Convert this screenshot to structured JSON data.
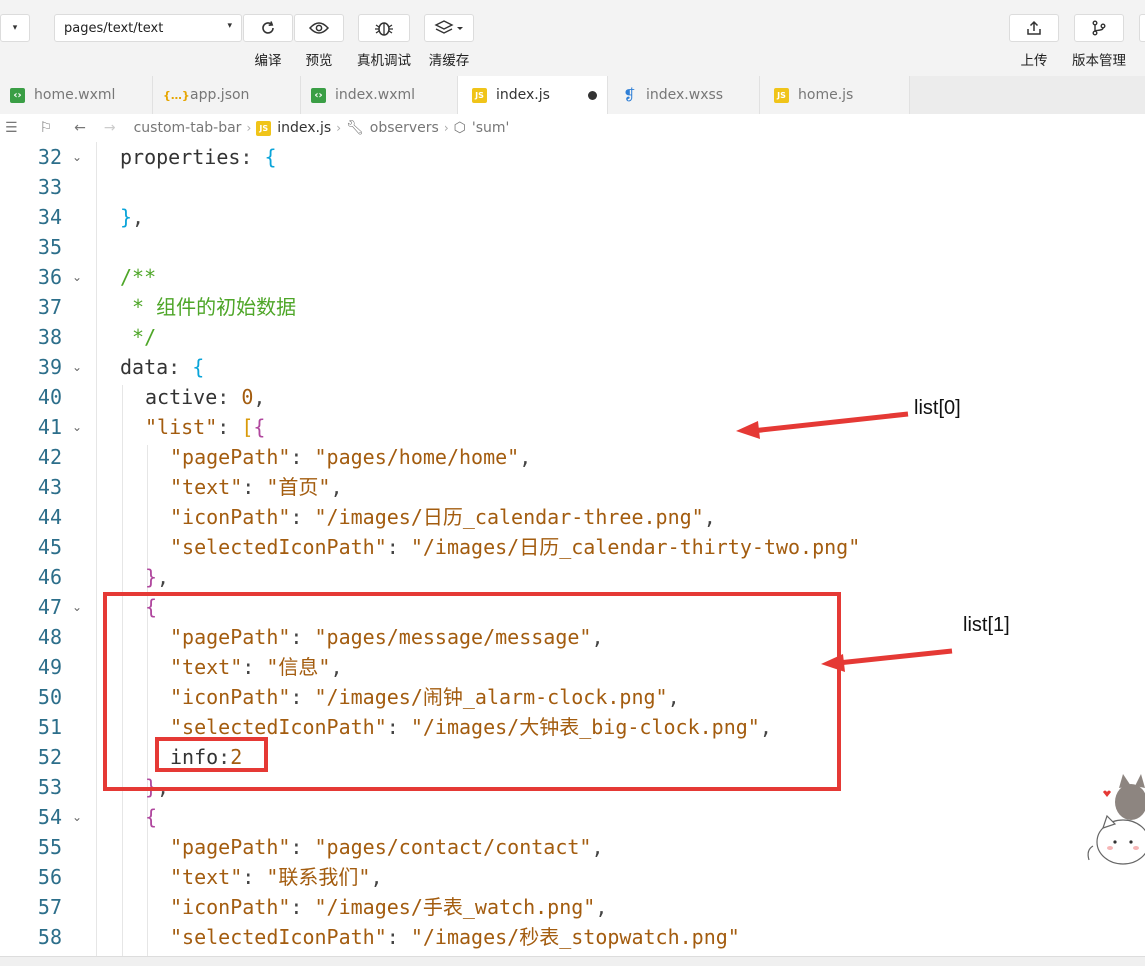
{
  "toolbar": {
    "path_value": "pages/text/text",
    "compile_label": "编译",
    "preview_label": "预览",
    "remote_debug_label": "真机调试",
    "clear_cache_label": "清缓存",
    "upload_label": "上传",
    "version_label": "版本管理"
  },
  "tabs": [
    {
      "label": "home.wxml",
      "icon": "wxml-file-icon"
    },
    {
      "label": "app.json",
      "icon": "json-file-icon"
    },
    {
      "label": "index.wxml",
      "icon": "wxml-file-icon"
    },
    {
      "label": "index.js",
      "icon": "js-file-icon",
      "active": true,
      "unsaved": true
    },
    {
      "label": "index.wxss",
      "icon": "css-file-icon"
    },
    {
      "label": "home.js",
      "icon": "js-file-icon"
    }
  ],
  "breadcrumb": {
    "folder": "custom-tab-bar",
    "file": "index.js",
    "section": "observers",
    "symbol": "'sum'"
  },
  "editor": {
    "line_numbers": [
      "32",
      "33",
      "34",
      "35",
      "36",
      "37",
      "38",
      "39",
      "40",
      "41",
      "42",
      "43",
      "44",
      "45",
      "46",
      "47",
      "48",
      "49",
      "50",
      "51",
      "52",
      "53",
      "54",
      "55",
      "56",
      "57",
      "58"
    ],
    "lines": {
      "l32_key": "properties",
      "l37_comment": " * 组件的初始数据",
      "l39_key": "data",
      "l40_key": "active",
      "l40_val": "0",
      "l41_key": "\"list\"",
      "l42_key": "\"pagePath\"",
      "l42_val": "\"pages/home/home\"",
      "l43_key": "\"text\"",
      "l43_val": "\"首页\"",
      "l44_key": "\"iconPath\"",
      "l44_val": "\"/images/日历_calendar-three.png\"",
      "l45_key": "\"selectedIconPath\"",
      "l45_val": "\"/images/日历_calendar-thirty-two.png\"",
      "l48_key": "\"pagePath\"",
      "l48_val": "\"pages/message/message\"",
      "l49_key": "\"text\"",
      "l49_val": "\"信息\"",
      "l50_key": "\"iconPath\"",
      "l50_val": "\"/images/闹钟_alarm-clock.png\"",
      "l51_key": "\"selectedIconPath\"",
      "l51_val": "\"/images/大钟表_big-clock.png\"",
      "l52_key": "info",
      "l52_val": "2",
      "l55_key": "\"pagePath\"",
      "l55_val": "\"pages/contact/contact\"",
      "l56_key": "\"text\"",
      "l56_val": "\"联系我们\"",
      "l57_key": "\"iconPath\"",
      "l57_val": "\"/images/手表_watch.png\"",
      "l58_key": "\"selectedIconPath\"",
      "l58_val": "\"/images/秒表_stopwatch.png\""
    }
  },
  "annotations": {
    "list0_label": "list[0]",
    "list1_label": "list[1]",
    "color": "#e53935"
  }
}
